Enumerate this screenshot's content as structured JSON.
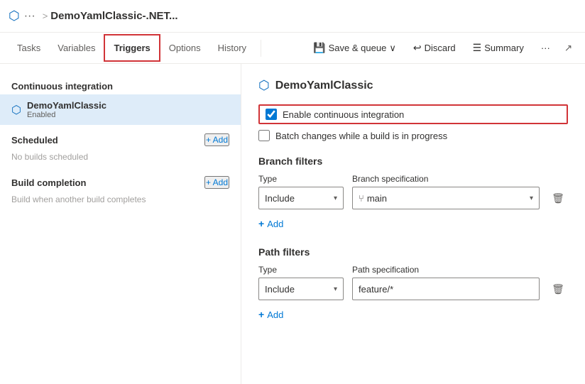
{
  "header": {
    "icon": "⬡",
    "dots": "···",
    "separator": ">",
    "title": "DemoYamlClassic-.NET...",
    "expand_icon": "↗"
  },
  "nav": {
    "tabs": [
      {
        "id": "tasks",
        "label": "Tasks",
        "active": false,
        "highlighted": false
      },
      {
        "id": "variables",
        "label": "Variables",
        "active": false,
        "highlighted": false
      },
      {
        "id": "triggers",
        "label": "Triggers",
        "active": false,
        "highlighted": true
      },
      {
        "id": "options",
        "label": "Options",
        "active": false,
        "highlighted": false
      },
      {
        "id": "history",
        "label": "History",
        "active": false,
        "highlighted": false
      }
    ],
    "actions": {
      "save_queue": "Save & queue",
      "save_arrow": "∨",
      "discard": "Discard",
      "summary": "Summary",
      "more": "···"
    }
  },
  "sidebar": {
    "continuous_integration": {
      "title": "Continuous integration",
      "item": {
        "name": "DemoYamlClassic",
        "status": "Enabled"
      }
    },
    "scheduled": {
      "title": "Scheduled",
      "add_label": "+ Add",
      "empty_message": "No builds scheduled"
    },
    "build_completion": {
      "title": "Build completion",
      "add_label": "+ Add",
      "description": "Build when another build completes"
    }
  },
  "content": {
    "title": "DemoYamlClassic",
    "icon": "⬡",
    "enable_ci_label": "Enable continuous integration",
    "batch_changes_label": "Batch changes while a build is in progress",
    "branch_filters": {
      "title": "Branch filters",
      "type_label": "Type",
      "spec_label": "Branch specification",
      "row": {
        "type": "Include",
        "spec": "main",
        "spec_icon": "⑂"
      },
      "add_label": "Add"
    },
    "path_filters": {
      "title": "Path filters",
      "type_label": "Type",
      "spec_label": "Path specification",
      "row": {
        "type": "Include",
        "spec": "feature/*"
      },
      "add_label": "Add"
    }
  }
}
